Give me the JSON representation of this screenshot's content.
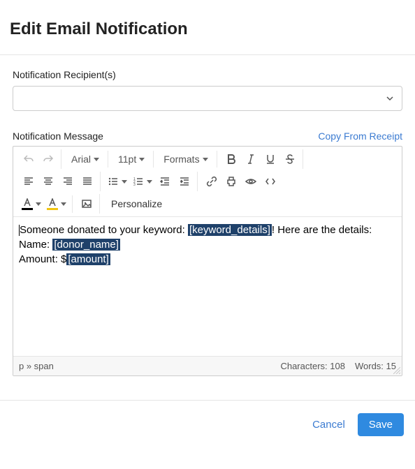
{
  "header": {
    "title": "Edit Email Notification"
  },
  "recipients": {
    "label": "Notification Recipient(s)",
    "value": ""
  },
  "message": {
    "label": "Notification Message",
    "copy_link": "Copy From Receipt"
  },
  "toolbar": {
    "font_family": "Arial",
    "font_size": "11pt",
    "formats": "Formats",
    "personalize": "Personalize"
  },
  "content": {
    "line1_a": "Someone donated to your keyword: ",
    "tag1": "[keyword_details]",
    "line1_b": "! Here are the details:",
    "line2_a": "Name: ",
    "tag2": "[donor_name]",
    "line3_a": "Amount: $",
    "tag3": "[amount]"
  },
  "status": {
    "path": "p » span",
    "chars_label": "Characters: ",
    "chars_value": "108",
    "words_label": "Words: ",
    "words_value": "15"
  },
  "footer": {
    "cancel": "Cancel",
    "save": "Save"
  }
}
